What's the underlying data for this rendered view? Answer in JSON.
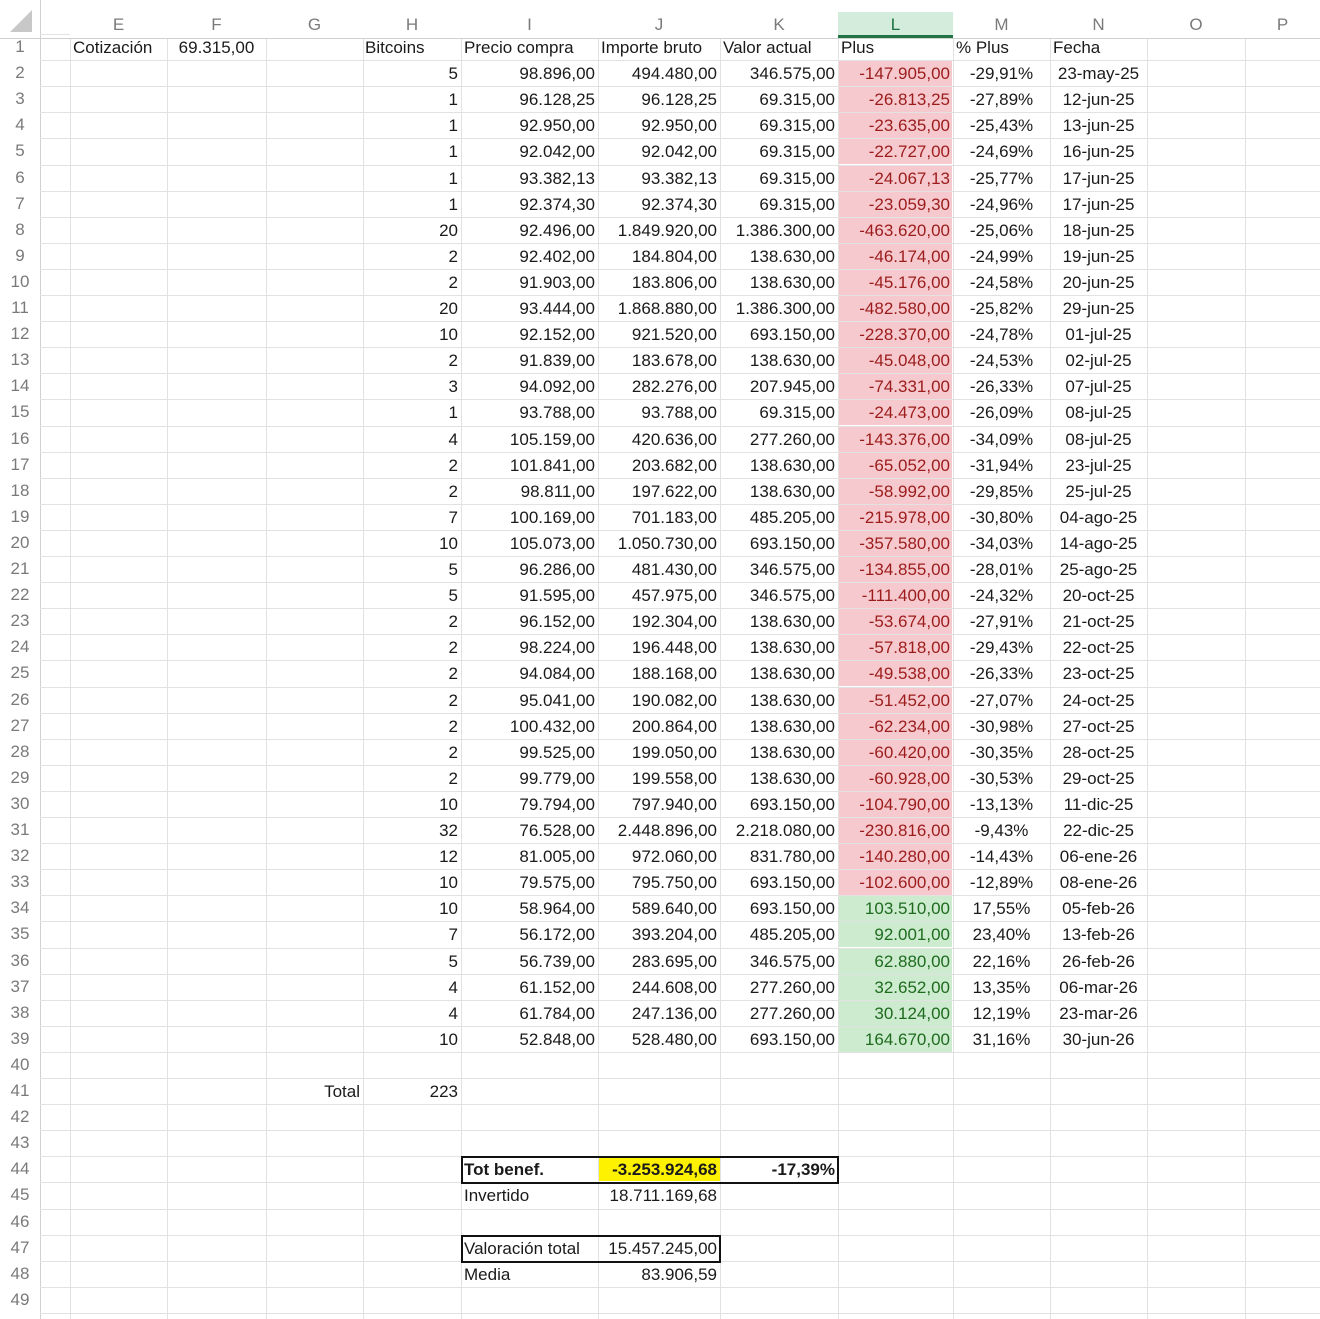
{
  "columns": [
    "E",
    "F",
    "G",
    "H",
    "I",
    "J",
    "K",
    "L",
    "M",
    "N",
    "O",
    "P"
  ],
  "selected_column": "L",
  "header_row": {
    "E": "Cotización",
    "F": "69.315,00",
    "H": "Bitcoins",
    "I": "Precio compra",
    "J": "Importe bruto",
    "K": "Valor actual",
    "L": "Plus",
    "M": "% Plus",
    "N": "Fecha"
  },
  "rows": [
    {
      "row": "2",
      "bitcoins": "5",
      "precio": "98.896,00",
      "importe": "494.480,00",
      "valor": "346.575,00",
      "plus": "-147.905,00",
      "pct": "-29,91%",
      "fecha": "23-may-25",
      "sign": "neg"
    },
    {
      "row": "3",
      "bitcoins": "1",
      "precio": "96.128,25",
      "importe": "96.128,25",
      "valor": "69.315,00",
      "plus": "-26.813,25",
      "pct": "-27,89%",
      "fecha": "12-jun-25",
      "sign": "neg"
    },
    {
      "row": "4",
      "bitcoins": "1",
      "precio": "92.950,00",
      "importe": "92.950,00",
      "valor": "69.315,00",
      "plus": "-23.635,00",
      "pct": "-25,43%",
      "fecha": "13-jun-25",
      "sign": "neg"
    },
    {
      "row": "5",
      "bitcoins": "1",
      "precio": "92.042,00",
      "importe": "92.042,00",
      "valor": "69.315,00",
      "plus": "-22.727,00",
      "pct": "-24,69%",
      "fecha": "16-jun-25",
      "sign": "neg"
    },
    {
      "row": "6",
      "bitcoins": "1",
      "precio": "93.382,13",
      "importe": "93.382,13",
      "valor": "69.315,00",
      "plus": "-24.067,13",
      "pct": "-25,77%",
      "fecha": "17-jun-25",
      "sign": "neg"
    },
    {
      "row": "7",
      "bitcoins": "1",
      "precio": "92.374,30",
      "importe": "92.374,30",
      "valor": "69.315,00",
      "plus": "-23.059,30",
      "pct": "-24,96%",
      "fecha": "17-jun-25",
      "sign": "neg"
    },
    {
      "row": "8",
      "bitcoins": "20",
      "precio": "92.496,00",
      "importe": "1.849.920,00",
      "valor": "1.386.300,00",
      "plus": "-463.620,00",
      "pct": "-25,06%",
      "fecha": "18-jun-25",
      "sign": "neg"
    },
    {
      "row": "9",
      "bitcoins": "2",
      "precio": "92.402,00",
      "importe": "184.804,00",
      "valor": "138.630,00",
      "plus": "-46.174,00",
      "pct": "-24,99%",
      "fecha": "19-jun-25",
      "sign": "neg"
    },
    {
      "row": "10",
      "bitcoins": "2",
      "precio": "91.903,00",
      "importe": "183.806,00",
      "valor": "138.630,00",
      "plus": "-45.176,00",
      "pct": "-24,58%",
      "fecha": "20-jun-25",
      "sign": "neg"
    },
    {
      "row": "11",
      "bitcoins": "20",
      "precio": "93.444,00",
      "importe": "1.868.880,00",
      "valor": "1.386.300,00",
      "plus": "-482.580,00",
      "pct": "-25,82%",
      "fecha": "29-jun-25",
      "sign": "neg"
    },
    {
      "row": "12",
      "bitcoins": "10",
      "precio": "92.152,00",
      "importe": "921.520,00",
      "valor": "693.150,00",
      "plus": "-228.370,00",
      "pct": "-24,78%",
      "fecha": "01-jul-25",
      "sign": "neg"
    },
    {
      "row": "13",
      "bitcoins": "2",
      "precio": "91.839,00",
      "importe": "183.678,00",
      "valor": "138.630,00",
      "plus": "-45.048,00",
      "pct": "-24,53%",
      "fecha": "02-jul-25",
      "sign": "neg"
    },
    {
      "row": "14",
      "bitcoins": "3",
      "precio": "94.092,00",
      "importe": "282.276,00",
      "valor": "207.945,00",
      "plus": "-74.331,00",
      "pct": "-26,33%",
      "fecha": "07-jul-25",
      "sign": "neg"
    },
    {
      "row": "15",
      "bitcoins": "1",
      "precio": "93.788,00",
      "importe": "93.788,00",
      "valor": "69.315,00",
      "plus": "-24.473,00",
      "pct": "-26,09%",
      "fecha": "08-jul-25",
      "sign": "neg"
    },
    {
      "row": "16",
      "bitcoins": "4",
      "precio": "105.159,00",
      "importe": "420.636,00",
      "valor": "277.260,00",
      "plus": "-143.376,00",
      "pct": "-34,09%",
      "fecha": "08-jul-25",
      "sign": "neg"
    },
    {
      "row": "17",
      "bitcoins": "2",
      "precio": "101.841,00",
      "importe": "203.682,00",
      "valor": "138.630,00",
      "plus": "-65.052,00",
      "pct": "-31,94%",
      "fecha": "23-jul-25",
      "sign": "neg"
    },
    {
      "row": "18",
      "bitcoins": "2",
      "precio": "98.811,00",
      "importe": "197.622,00",
      "valor": "138.630,00",
      "plus": "-58.992,00",
      "pct": "-29,85%",
      "fecha": "25-jul-25",
      "sign": "neg"
    },
    {
      "row": "19",
      "bitcoins": "7",
      "precio": "100.169,00",
      "importe": "701.183,00",
      "valor": "485.205,00",
      "plus": "-215.978,00",
      "pct": "-30,80%",
      "fecha": "04-ago-25",
      "sign": "neg"
    },
    {
      "row": "20",
      "bitcoins": "10",
      "precio": "105.073,00",
      "importe": "1.050.730,00",
      "valor": "693.150,00",
      "plus": "-357.580,00",
      "pct": "-34,03%",
      "fecha": "14-ago-25",
      "sign": "neg"
    },
    {
      "row": "21",
      "bitcoins": "5",
      "precio": "96.286,00",
      "importe": "481.430,00",
      "valor": "346.575,00",
      "plus": "-134.855,00",
      "pct": "-28,01%",
      "fecha": "25-ago-25",
      "sign": "neg"
    },
    {
      "row": "22",
      "bitcoins": "5",
      "precio": "91.595,00",
      "importe": "457.975,00",
      "valor": "346.575,00",
      "plus": "-111.400,00",
      "pct": "-24,32%",
      "fecha": "20-oct-25",
      "sign": "neg"
    },
    {
      "row": "23",
      "bitcoins": "2",
      "precio": "96.152,00",
      "importe": "192.304,00",
      "valor": "138.630,00",
      "plus": "-53.674,00",
      "pct": "-27,91%",
      "fecha": "21-oct-25",
      "sign": "neg"
    },
    {
      "row": "24",
      "bitcoins": "2",
      "precio": "98.224,00",
      "importe": "196.448,00",
      "valor": "138.630,00",
      "plus": "-57.818,00",
      "pct": "-29,43%",
      "fecha": "22-oct-25",
      "sign": "neg"
    },
    {
      "row": "25",
      "bitcoins": "2",
      "precio": "94.084,00",
      "importe": "188.168,00",
      "valor": "138.630,00",
      "plus": "-49.538,00",
      "pct": "-26,33%",
      "fecha": "23-oct-25",
      "sign": "neg"
    },
    {
      "row": "26",
      "bitcoins": "2",
      "precio": "95.041,00",
      "importe": "190.082,00",
      "valor": "138.630,00",
      "plus": "-51.452,00",
      "pct": "-27,07%",
      "fecha": "24-oct-25",
      "sign": "neg"
    },
    {
      "row": "27",
      "bitcoins": "2",
      "precio": "100.432,00",
      "importe": "200.864,00",
      "valor": "138.630,00",
      "plus": "-62.234,00",
      "pct": "-30,98%",
      "fecha": "27-oct-25",
      "sign": "neg"
    },
    {
      "row": "28",
      "bitcoins": "2",
      "precio": "99.525,00",
      "importe": "199.050,00",
      "valor": "138.630,00",
      "plus": "-60.420,00",
      "pct": "-30,35%",
      "fecha": "28-oct-25",
      "sign": "neg"
    },
    {
      "row": "29",
      "bitcoins": "2",
      "precio": "99.779,00",
      "importe": "199.558,00",
      "valor": "138.630,00",
      "plus": "-60.928,00",
      "pct": "-30,53%",
      "fecha": "29-oct-25",
      "sign": "neg"
    },
    {
      "row": "30",
      "bitcoins": "10",
      "precio": "79.794,00",
      "importe": "797.940,00",
      "valor": "693.150,00",
      "plus": "-104.790,00",
      "pct": "-13,13%",
      "fecha": "11-dic-25",
      "sign": "neg"
    },
    {
      "row": "31",
      "bitcoins": "32",
      "precio": "76.528,00",
      "importe": "2.448.896,00",
      "valor": "2.218.080,00",
      "plus": "-230.816,00",
      "pct": "-9,43%",
      "fecha": "22-dic-25",
      "sign": "neg"
    },
    {
      "row": "32",
      "bitcoins": "12",
      "precio": "81.005,00",
      "importe": "972.060,00",
      "valor": "831.780,00",
      "plus": "-140.280,00",
      "pct": "-14,43%",
      "fecha": "06-ene-26",
      "sign": "neg"
    },
    {
      "row": "33",
      "bitcoins": "10",
      "precio": "79.575,00",
      "importe": "795.750,00",
      "valor": "693.150,00",
      "plus": "-102.600,00",
      "pct": "-12,89%",
      "fecha": "08-ene-26",
      "sign": "neg"
    },
    {
      "row": "34",
      "bitcoins": "10",
      "precio": "58.964,00",
      "importe": "589.640,00",
      "valor": "693.150,00",
      "plus": "103.510,00",
      "pct": "17,55%",
      "fecha": "05-feb-26",
      "sign": "pos"
    },
    {
      "row": "35",
      "bitcoins": "7",
      "precio": "56.172,00",
      "importe": "393.204,00",
      "valor": "485.205,00",
      "plus": "92.001,00",
      "pct": "23,40%",
      "fecha": "13-feb-26",
      "sign": "pos"
    },
    {
      "row": "36",
      "bitcoins": "5",
      "precio": "56.739,00",
      "importe": "283.695,00",
      "valor": "346.575,00",
      "plus": "62.880,00",
      "pct": "22,16%",
      "fecha": "26-feb-26",
      "sign": "pos"
    },
    {
      "row": "37",
      "bitcoins": "4",
      "precio": "61.152,00",
      "importe": "244.608,00",
      "valor": "277.260,00",
      "plus": "32.652,00",
      "pct": "13,35%",
      "fecha": "06-mar-26",
      "sign": "pos"
    },
    {
      "row": "38",
      "bitcoins": "4",
      "precio": "61.784,00",
      "importe": "247.136,00",
      "valor": "277.260,00",
      "plus": "30.124,00",
      "pct": "12,19%",
      "fecha": "23-mar-26",
      "sign": "pos"
    },
    {
      "row": "39",
      "bitcoins": "10",
      "precio": "52.848,00",
      "importe": "528.480,00",
      "valor": "693.150,00",
      "plus": "164.670,00",
      "pct": "31,16%",
      "fecha": "30-jun-26",
      "sign": "pos"
    }
  ],
  "footer_row_numbers": [
    "40",
    "41",
    "42",
    "43",
    "44",
    "45",
    "46",
    "47",
    "48",
    "49"
  ],
  "summary": {
    "total_label": "Total",
    "total_value": "223",
    "tot_benef_label": "Tot benef.",
    "tot_benef_value": "-3.253.924,68",
    "tot_benef_pct": "-17,39%",
    "invertido_label": "Invertido",
    "invertido_value": "18.711.169,68",
    "valoracion_label": "Valoración total",
    "valoracion_value": "15.457.245,00",
    "media_label": "Media",
    "media_value": "83.906,59"
  },
  "colors": {
    "negative_fill": "#f5c9cd",
    "negative_text": "#9c1c1c",
    "positive_fill": "#cdebcf",
    "positive_text": "#1e6b1e",
    "highlight": "#fff200",
    "selected_header": "#d3ecdb"
  }
}
